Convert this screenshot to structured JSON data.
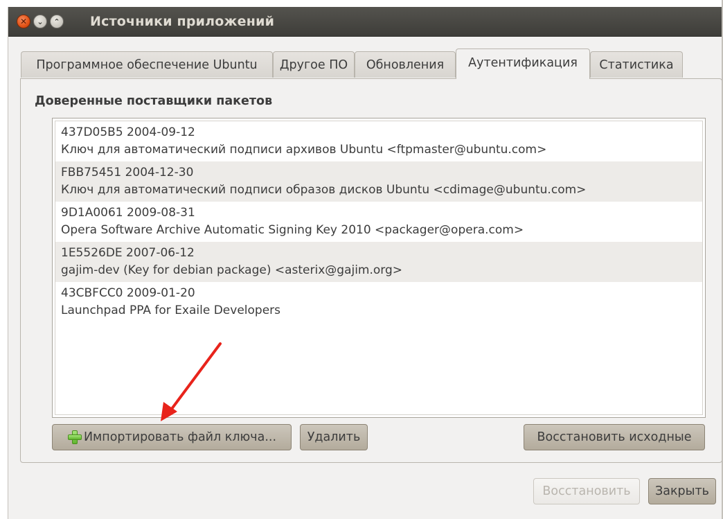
{
  "window": {
    "title": "Источники приложений"
  },
  "tabs": [
    {
      "label": "Программное обеспечение Ubuntu"
    },
    {
      "label": "Другое ПО"
    },
    {
      "label": "Обновления"
    },
    {
      "label": "Аутентификация"
    },
    {
      "label": "Статистика"
    }
  ],
  "authentication": {
    "section_title": "Доверенные поставщики пакетов",
    "keys": [
      {
        "id_date": "437D05B5 2004-09-12",
        "description": "Ключ для автоматический подписи архивов Ubuntu <ftpmaster@ubuntu.com>"
      },
      {
        "id_date": "FBB75451 2004-12-30",
        "description": "Ключ для автоматический подписи образов дисков Ubuntu <cdimage@ubuntu.com>"
      },
      {
        "id_date": "9D1A0061 2009-08-31",
        "description": "Opera Software Archive Automatic Signing Key 2010 <packager@opera.com>"
      },
      {
        "id_date": "1E5526DE 2007-06-12",
        "description": "gajim-dev (Key for debian package) <asterix@gajim.org>"
      },
      {
        "id_date": "43CBFCC0 2009-01-20",
        "description": "Launchpad PPA for Exaile Developers"
      }
    ],
    "import_button": "Импортировать файл ключа...",
    "remove_button": "Удалить",
    "restore_defaults_button": "Восстановить исходные"
  },
  "footer": {
    "revert_button": "Восстановить",
    "close_button": "Закрыть"
  },
  "colors": {
    "titlebar": "#3e3d39",
    "annotation_arrow": "#e8231b",
    "plus_icon": "#5fb52d"
  },
  "icons": [
    "close-icon",
    "minimize-icon",
    "maximize-icon",
    "plus-icon"
  ]
}
